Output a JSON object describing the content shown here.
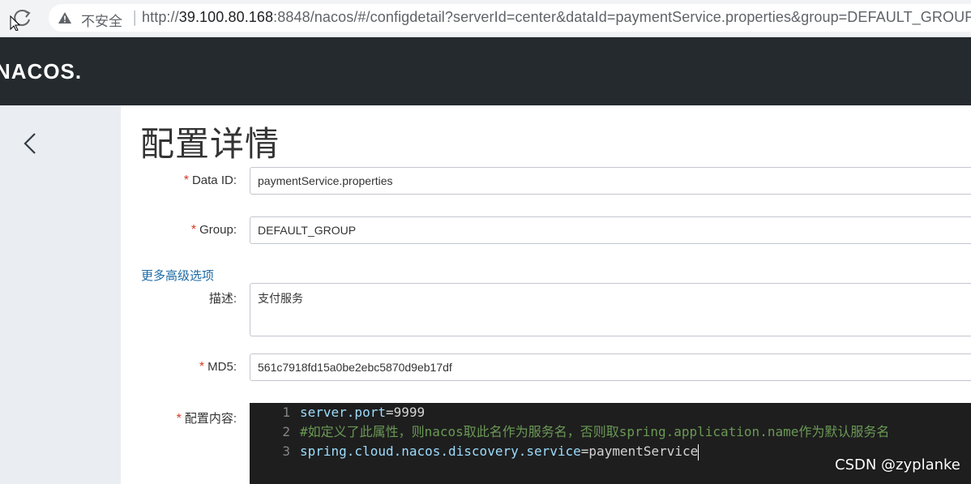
{
  "browser": {
    "security_label": "不安全",
    "separator": "|",
    "url_scheme": "http://",
    "url_host": "39.100.80.168",
    "url_rest": ":8848/nacos/#/configdetail?serverId=center&dataId=paymentService.properties&group=DEFAULT_GROUP"
  },
  "header": {
    "logo_text": "NACOS."
  },
  "page": {
    "title": "配置详情"
  },
  "form": {
    "required_mark": "*",
    "data_id_label": "Data ID:",
    "data_id_value": "paymentService.properties",
    "group_label": "Group:",
    "group_value": "DEFAULT_GROUP",
    "advanced_link": "更多高级选项",
    "desc_label": "描述:",
    "desc_value": "支付服务",
    "md5_label": "MD5:",
    "md5_value": "561c7918fd15a0be2ebc5870d9eb17df",
    "content_label": "配置内容:"
  },
  "editor": {
    "lines": [
      {
        "num": "1",
        "key": "server.port",
        "op": "=",
        "value": "9999",
        "comment": ""
      },
      {
        "num": "2",
        "key": "",
        "op": "",
        "value": "",
        "comment": "#如定义了此属性，则nacos取此名作为服务名，否则取spring.application.name作为默认服务名"
      },
      {
        "num": "3",
        "key": "spring.cloud.nacos.discovery.service",
        "op": "=",
        "value": "paymentService",
        "comment": ""
      }
    ]
  },
  "watermark": "CSDN @zyplanke",
  "colors": {
    "header_bg": "#252a2f",
    "sidebar_bg": "#eaedf1",
    "required": "#d23c26",
    "link": "#1c6aa6",
    "editor_bg": "#1e1e1e"
  }
}
